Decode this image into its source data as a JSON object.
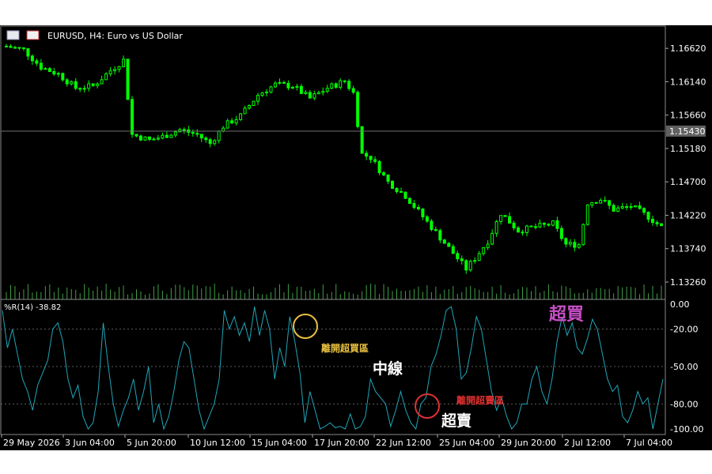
{
  "window": {
    "symbol_title": "EURUSD, H4:  Euro vs US Dollar"
  },
  "colors": {
    "background": "#000000",
    "candle": "#00ff00",
    "volume": "#3fa046",
    "wpr_line": "#1fa5b8",
    "level_line": "#5c5c5c",
    "axis_text": "#ffffff",
    "current_price_box": "#606060",
    "overbought_label": "#c850c8",
    "exit_overbought_label": "#e8c040",
    "exit_oversold_label": "#e03030"
  },
  "chart_data": [
    {
      "type": "candlestick",
      "symbol": "EURUSD",
      "timeframe": "H4",
      "title": "EURUSD, H4:  Euro vs US Dollar",
      "ylim": [
        1.1301,
        1.1694
      ],
      "y_ticks": [
        1.1662,
        1.1614,
        1.1566,
        1.1518,
        1.147,
        1.1422,
        1.1374,
        1.1326
      ],
      "y_tick_labels": [
        "1.16620",
        "1.16140",
        "1.15660",
        "1.15180",
        "1.14700",
        "1.14220",
        "1.13740",
        "1.13260"
      ],
      "current_price": 1.1543,
      "current_price_label": "1.15430",
      "x_tick_labels": [
        "29 May 2026",
        "3 Jun 04:00",
        "5 Jun 20:00",
        "10 Jun 12:00",
        "15 Jun 04:00",
        "17 Jun 20:00",
        "22 Jun 12:00",
        "25 Jun 04:00",
        "29 Jun 20:00",
        "2 Jul 12:00",
        "7 Jul 04:00"
      ],
      "close_path": [
        [
          0,
          1.1665
        ],
        [
          4,
          1.166
        ],
        [
          8,
          1.1635
        ],
        [
          12,
          1.1625
        ],
        [
          16,
          1.1605
        ],
        [
          20,
          1.1608
        ],
        [
          24,
          1.163
        ],
        [
          27,
          1.1645
        ],
        [
          29,
          1.1538
        ],
        [
          33,
          1.153
        ],
        [
          36,
          1.1535
        ],
        [
          40,
          1.1545
        ],
        [
          44,
          1.1538
        ],
        [
          47,
          1.1525
        ],
        [
          50,
          1.155
        ],
        [
          54,
          1.1565
        ],
        [
          58,
          1.1595
        ],
        [
          62,
          1.161
        ],
        [
          66,
          1.1608
        ],
        [
          70,
          1.159
        ],
        [
          74,
          1.1605
        ],
        [
          78,
          1.1615
        ],
        [
          80,
          1.1598
        ],
        [
          82,
          1.151
        ],
        [
          84,
          1.1505
        ],
        [
          88,
          1.147
        ],
        [
          92,
          1.145
        ],
        [
          96,
          1.142
        ],
        [
          100,
          1.139
        ],
        [
          104,
          1.136
        ],
        [
          106,
          1.1345
        ],
        [
          108,
          1.136
        ],
        [
          111,
          1.1385
        ],
        [
          114,
          1.1425
        ],
        [
          118,
          1.14
        ],
        [
          122,
          1.1405
        ],
        [
          126,
          1.141
        ],
        [
          129,
          1.138
        ],
        [
          132,
          1.138
        ],
        [
          134,
          1.144
        ],
        [
          137,
          1.1445
        ],
        [
          140,
          1.143
        ],
        [
          144,
          1.1435
        ],
        [
          148,
          1.142
        ],
        [
          151,
          1.1405
        ]
      ],
      "volume_note": "tick volume bars"
    },
    {
      "type": "line",
      "indicator": "Williams %R",
      "title": "%R(14) -38.82",
      "period": 14,
      "last_value": -38.82,
      "ylim": [
        -100,
        0
      ],
      "y_tick_labels": [
        "0.00",
        "-20.00",
        "-50.00",
        "-80.00",
        "-100.00"
      ],
      "levels": [
        -20,
        -50,
        -80
      ],
      "series": [
        {
          "values": [
            -5,
            -35,
            -20,
            -40,
            -60,
            -70,
            -85,
            -65,
            -55,
            -45,
            -20,
            -15,
            -30,
            -60,
            -75,
            -65,
            -90,
            -100,
            -95,
            -70,
            -15,
            -50,
            -80,
            -98,
            -85,
            -75,
            -60,
            -85,
            -70,
            -50,
            -95,
            -80,
            -100,
            -90,
            -70,
            -45,
            -30,
            -35,
            -60,
            -85,
            -100,
            -90,
            -80,
            -60,
            -5,
            -20,
            -10,
            -25,
            -15,
            -30,
            -2,
            -25,
            -5,
            -20,
            -60,
            -35,
            -50,
            -10,
            -30,
            -55,
            -95,
            -70,
            -85,
            -100,
            -98,
            -95,
            -99,
            -98,
            -100,
            -88,
            -100,
            -98,
            -90,
            -60,
            -70,
            -75,
            -80,
            -98,
            -85,
            -70,
            -85,
            -95,
            -100,
            -80,
            -75,
            -50,
            -40,
            -25,
            -5,
            -2,
            -20,
            -60,
            -55,
            -35,
            -10,
            -20,
            -45,
            -70,
            -85,
            -75,
            -90,
            -100,
            -95,
            -80,
            -80,
            -60,
            -50,
            -70,
            -80,
            -60,
            -30,
            -10,
            -25,
            -15,
            -35,
            -40,
            -28,
            -12,
            -20,
            -40,
            -60,
            -70,
            -65,
            -90,
            -95,
            -85,
            -70,
            -80,
            -75,
            -100,
            -80,
            -60
          ]
        }
      ],
      "annotations": [
        {
          "text": "離開超買區",
          "color_key": "exit_overbought_label",
          "kind": "exit-overbought"
        },
        {
          "text": "中線",
          "color_key": "axis_text",
          "kind": "midline"
        },
        {
          "text": "離開超賣區",
          "color_key": "exit_oversold_label",
          "kind": "exit-oversold"
        },
        {
          "text": "超賣",
          "color_key": "axis_text",
          "kind": "oversold"
        },
        {
          "text": "超買",
          "color_key": "overbought_label",
          "kind": "overbought"
        }
      ]
    }
  ]
}
